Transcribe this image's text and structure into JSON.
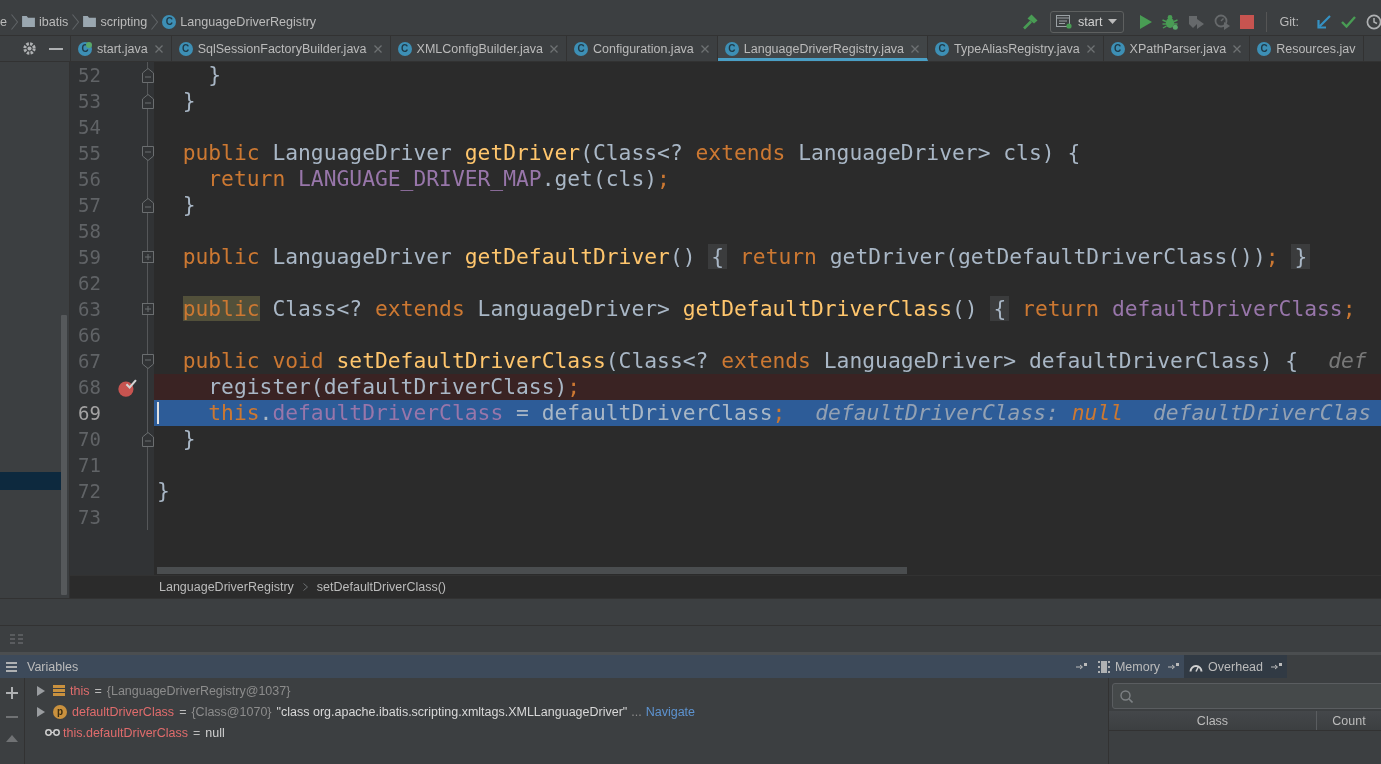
{
  "navigation": {
    "breadcrumbs": [
      {
        "kind": "text",
        "label": "e"
      },
      {
        "kind": "folder",
        "label": "ibatis"
      },
      {
        "kind": "folder",
        "label": "scripting"
      },
      {
        "kind": "class",
        "icon": "C",
        "label": "LanguageDriverRegistry"
      }
    ],
    "build": {
      "disabled": false
    },
    "run_config": "start",
    "run_actions": [
      {
        "kind": "run",
        "disabled": false
      },
      {
        "kind": "debug",
        "disabled": false
      },
      {
        "kind": "coverage",
        "disabled": true
      },
      {
        "kind": "profile",
        "disabled": true
      },
      {
        "kind": "stop",
        "disabled": false
      }
    ],
    "vcs_label": "Git:",
    "vcs_actions": [
      {
        "kind": "update"
      },
      {
        "kind": "commit"
      },
      {
        "kind": "history"
      }
    ]
  },
  "tabs": [
    {
      "label": "start.java",
      "icon": "C",
      "runnable": true,
      "closable": true,
      "selected": false
    },
    {
      "label": "SqlSessionFactoryBuilder.java",
      "icon": "C",
      "runnable": false,
      "closable": true,
      "selected": false
    },
    {
      "label": "XMLConfigBuilder.java",
      "icon": "C",
      "runnable": false,
      "closable": true,
      "selected": false
    },
    {
      "label": "Configuration.java",
      "icon": "C",
      "runnable": false,
      "closable": true,
      "selected": false
    },
    {
      "label": "LanguageDriverRegistry.java",
      "icon": "C",
      "runnable": false,
      "closable": true,
      "selected": true
    },
    {
      "label": "TypeAliasRegistry.java",
      "icon": "C",
      "runnable": false,
      "closable": true,
      "selected": false
    },
    {
      "label": "XPathParser.java",
      "icon": "C",
      "runnable": false,
      "closable": true,
      "selected": false
    },
    {
      "label": "Resources.jav",
      "icon": "C",
      "runnable": false,
      "closable": false,
      "selected": false
    }
  ],
  "editor": {
    "lines": [
      {
        "number": "52",
        "fold": {
          "kind": "end"
        },
        "breakpoint": false,
        "current": false,
        "tokens": [
          {
            "text": "    }",
            "kind": "plain"
          }
        ]
      },
      {
        "number": "53",
        "fold": {
          "kind": "end"
        },
        "breakpoint": false,
        "current": false,
        "tokens": [
          {
            "text": "  }",
            "kind": "plain"
          }
        ]
      },
      {
        "number": "54",
        "breakpoint": false,
        "current": false
      },
      {
        "number": "55",
        "fold": {
          "kind": "start"
        },
        "breakpoint": false,
        "current": false,
        "tokens": [
          {
            "text": "  public",
            "kind": "keyword"
          },
          {
            "text": " LanguageDriver ",
            "kind": "plain"
          },
          {
            "text": "getDriver",
            "kind": "method"
          },
          {
            "text": "(Class<? ",
            "kind": "plain"
          },
          {
            "text": "extends",
            "kind": "keyword"
          },
          {
            "text": " LanguageDriver> cls) {",
            "kind": "plain"
          }
        ]
      },
      {
        "number": "56",
        "breakpoint": false,
        "current": false,
        "tokens": [
          {
            "text": "    return",
            "kind": "keyword"
          },
          {
            "text": " LANGUAGE_DRIVER_MAP",
            "kind": "field"
          },
          {
            "text": ".get(cls)",
            "kind": "plain"
          },
          {
            "text": ";",
            "kind": "keyword"
          }
        ]
      },
      {
        "number": "57",
        "fold": {
          "kind": "end"
        },
        "breakpoint": false,
        "current": false,
        "tokens": [
          {
            "text": "  }",
            "kind": "plain"
          }
        ]
      },
      {
        "number": "58",
        "breakpoint": false,
        "current": false
      },
      {
        "number": "59",
        "fold": {
          "kind": "folded"
        },
        "breakpoint": false,
        "current": false,
        "tokens": [
          {
            "text": "  public",
            "kind": "keyword"
          },
          {
            "text": " LanguageDriver ",
            "kind": "plain"
          },
          {
            "text": "getDefaultDriver",
            "kind": "method"
          },
          {
            "text": "() ",
            "kind": "plain"
          },
          {
            "text": "{",
            "kind": "folded"
          },
          {
            "text": " return",
            "kind": "keyword"
          },
          {
            "text": " getDriver(getDefaultDriverClass())",
            "kind": "plain"
          },
          {
            "text": "; ",
            "kind": "keyword"
          },
          {
            "text": "}",
            "kind": "folded"
          }
        ]
      },
      {
        "number": "62",
        "breakpoint": false,
        "current": false
      },
      {
        "number": "63",
        "fold": {
          "kind": "folded"
        },
        "breakpoint": false,
        "current": false,
        "tokens": [
          {
            "text": "  public",
            "kind": "keyword_marked"
          },
          {
            "text": " Class<? ",
            "kind": "plain"
          },
          {
            "text": "extends",
            "kind": "keyword"
          },
          {
            "text": " LanguageDriver> ",
            "kind": "plain"
          },
          {
            "text": "getDefaultDriverClass",
            "kind": "method"
          },
          {
            "text": "() ",
            "kind": "plain"
          },
          {
            "text": "{",
            "kind": "folded"
          },
          {
            "text": " return",
            "kind": "keyword"
          },
          {
            "text": " defaultDriverClass",
            "kind": "field"
          },
          {
            "text": ";",
            "kind": "keyword"
          }
        ]
      },
      {
        "number": "66",
        "breakpoint": false,
        "current": false
      },
      {
        "number": "67",
        "fold": {
          "kind": "start"
        },
        "breakpoint": false,
        "current": false,
        "tokens": [
          {
            "text": "  public void ",
            "kind": "keyword"
          },
          {
            "text": "setDefaultDriverClass",
            "kind": "method"
          },
          {
            "text": "(Class<? ",
            "kind": "plain"
          },
          {
            "text": "extends",
            "kind": "keyword"
          },
          {
            "text": " LanguageDriver> defaultDriverClass) {",
            "kind": "plain"
          }
        ],
        "hints": [
          {
            "label": "def"
          }
        ]
      },
      {
        "number": "68",
        "breakpoint": true,
        "current": false,
        "tokens": [
          {
            "text": "    register(defaultDriverClass)",
            "kind": "plain"
          },
          {
            "text": ";",
            "kind": "keyword"
          }
        ]
      },
      {
        "number": "69",
        "breakpoint": false,
        "current": true,
        "tokens": [
          {
            "text": "    this",
            "kind": "keyword"
          },
          {
            "text": ".",
            "kind": "plain"
          },
          {
            "text": "defaultDriverClass",
            "kind": "field"
          },
          {
            "text": " = defaultDriverClass",
            "kind": "plain"
          },
          {
            "text": ";",
            "kind": "keyword"
          }
        ],
        "hints": [
          {
            "label": "defaultDriverClass:",
            "value": "null"
          },
          {
            "label": "defaultDriverClas"
          }
        ]
      },
      {
        "number": "70",
        "fold": {
          "kind": "end"
        },
        "breakpoint": false,
        "current": false,
        "tokens": [
          {
            "text": "  }",
            "kind": "plain"
          }
        ]
      },
      {
        "number": "71",
        "breakpoint": false,
        "current": false
      },
      {
        "number": "72",
        "breakpoint": false,
        "current": false,
        "tokens": [
          {
            "text": "}",
            "kind": "plain"
          }
        ]
      },
      {
        "number": "73",
        "breakpoint": false,
        "current": false
      }
    ],
    "breadcrumbs": [
      "LanguageDriverRegistry",
      "setDefaultDriverClass()"
    ]
  },
  "debugger": {
    "title": "Variables",
    "view_tabs": [
      {
        "kind": "memory",
        "label": "Memory",
        "selected": false
      },
      {
        "kind": "overhead",
        "label": "Overhead",
        "selected": true
      }
    ],
    "toolbar": [
      {
        "kind": "add",
        "disabled": false
      },
      {
        "kind": "remove",
        "disabled": true
      },
      {
        "kind": "up",
        "disabled": true
      }
    ],
    "variables": [
      {
        "kind": "object",
        "name": "this",
        "op": "=",
        "value": "{LanguageDriverRegistry@1037}",
        "expandable": true
      },
      {
        "kind": "parameter",
        "icon": "p",
        "name": "defaultDriverClass",
        "op": "=",
        "value": "{Class@1070}",
        "text": "\"class org.apache.ibatis.scripting.xmltags.XMLLanguageDriver\"",
        "more": "...",
        "link": "Navigate",
        "expandable": true
      },
      {
        "kind": "watch",
        "name": "this.defaultDriverClass",
        "op": "=",
        "value": "null",
        "expandable": false
      }
    ],
    "memory": {
      "columns": [
        "Class",
        "Count"
      ]
    }
  }
}
